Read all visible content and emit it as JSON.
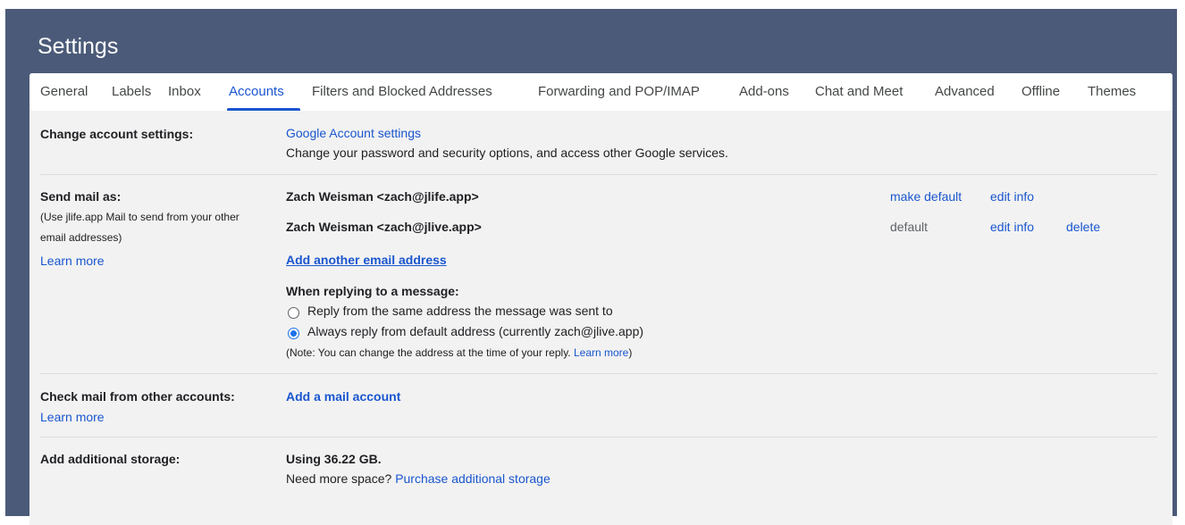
{
  "header": {
    "title": "Settings"
  },
  "tabs": [
    {
      "label": "General"
    },
    {
      "label": "Labels"
    },
    {
      "label": "Inbox"
    },
    {
      "label": "Accounts"
    },
    {
      "label": "Filters and Blocked Addresses"
    },
    {
      "label": "Forwarding and POP/IMAP"
    },
    {
      "label": "Add-ons"
    },
    {
      "label": "Chat and Meet"
    },
    {
      "label": "Advanced"
    },
    {
      "label": "Offline"
    },
    {
      "label": "Themes"
    }
  ],
  "active_tab": "Accounts",
  "change_account": {
    "label": "Change account settings:",
    "link": "Google Account settings",
    "description": "Change your password and security options, and access other Google services."
  },
  "send_mail": {
    "label": "Send mail as:",
    "note_line1": "(Use jlife.app Mail to send from your other",
    "note_line2": "email addresses)",
    "learn_more": "Learn more",
    "addresses": [
      {
        "address": "Zach Weisman <zach@jlife.app>",
        "make_default": "make default",
        "edit_info": "edit info"
      },
      {
        "address": "Zach Weisman <zach@jlive.app>",
        "status": "default",
        "edit_info": "edit info",
        "delete": "delete"
      }
    ],
    "add_another": "Add another email address",
    "replying_heading": "When replying to a message:",
    "reply_option_same": "Reply from the same address the message was sent to",
    "reply_option_default": "Always reply from default address (currently zach@jlive.app)",
    "reply_selected": "default",
    "note_prefix": "(Note: You can change the address at the time of your reply. ",
    "note_link": "Learn more",
    "note_suffix": ")"
  },
  "check_mail": {
    "label": "Check mail from other accounts:",
    "learn_more": "Learn more",
    "add_account": "Add a mail account"
  },
  "storage": {
    "label": "Add additional storage:",
    "usage": "Using 36.22 GB.",
    "need_more": "Need more space? ",
    "purchase_link": "Purchase additional storage"
  },
  "colors": {
    "header_bg": "#4b5a78",
    "accent": "#1a56cf",
    "panel_bg": "#f2f2f2"
  }
}
